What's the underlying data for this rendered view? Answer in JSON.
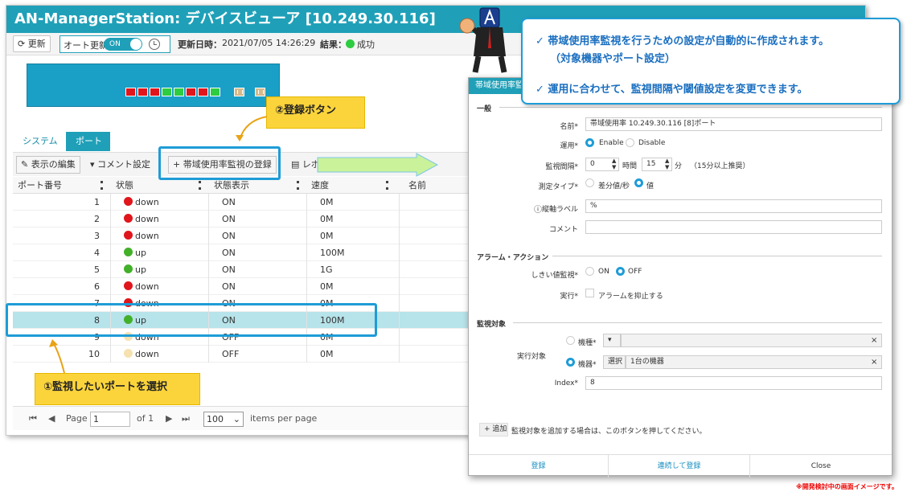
{
  "window": {
    "title": "AN-ManagerStation: デバイスビューア [10.249.30.116]"
  },
  "topbar": {
    "refresh_label": "更新",
    "auto_refresh_label": "オート更新",
    "toggle_label": "ON",
    "updated_label": "更新日時：",
    "updated_value": "2021/07/05 14:26:29",
    "result_label": "結果：",
    "result_value": "成功",
    "result_color": "#2ecc40"
  },
  "device": {
    "ports": [
      "red",
      "red",
      "red",
      "green",
      "green",
      "red",
      "red",
      "green",
      "tan",
      "tan"
    ]
  },
  "tabs": {
    "system": "システム",
    "port": "ポート"
  },
  "toolbar": {
    "edit_display": "表示の編集",
    "comment_settings": "コメント設定",
    "register_bw": "帯域使用率監視の登録",
    "report": "レポー"
  },
  "grid": {
    "headers": [
      "ポート番号",
      "状態",
      "状態表示",
      "速度",
      "名前"
    ],
    "rows": [
      {
        "port": "1",
        "status": "down",
        "status_color": "#e0161c",
        "display": "ON",
        "speed": "0M"
      },
      {
        "port": "2",
        "status": "down",
        "status_color": "#e0161c",
        "display": "ON",
        "speed": "0M"
      },
      {
        "port": "3",
        "status": "down",
        "status_color": "#e0161c",
        "display": "ON",
        "speed": "0M"
      },
      {
        "port": "4",
        "status": "up",
        "status_color": "#43b02a",
        "display": "ON",
        "speed": "100M"
      },
      {
        "port": "5",
        "status": "up",
        "status_color": "#43b02a",
        "display": "ON",
        "speed": "1G"
      },
      {
        "port": "6",
        "status": "down",
        "status_color": "#e0161c",
        "display": "ON",
        "speed": "0M"
      },
      {
        "port": "7",
        "status": "down",
        "status_color": "#e0161c",
        "display": "ON",
        "speed": "0M"
      },
      {
        "port": "8",
        "status": "up",
        "status_color": "#43b02a",
        "display": "ON",
        "speed": "100M"
      },
      {
        "port": "9",
        "status": "down",
        "status_color": "#f6e2b0",
        "display": "OFF",
        "speed": "0M"
      },
      {
        "port": "10",
        "status": "down",
        "status_color": "#f6e2b0",
        "display": "OFF",
        "speed": "0M"
      }
    ],
    "selected_port": "8"
  },
  "pager": {
    "page_label": "Page",
    "page_value": "1",
    "of_label": "of 1",
    "per_page_value": "100",
    "per_page_label": "items per page"
  },
  "callouts": {
    "register_button": "②登録ボタン",
    "select_port": "①監視したいポートを選択"
  },
  "bubble": {
    "line1": "✓ 帯域使用率監視を行うための設定が自動的に作成されます。",
    "line2": "（対象機器やポート設定）",
    "line3": "✓ 運用に合わせて、監視間隔や閾値設定を変更できます。"
  },
  "dialog": {
    "title": "帯域使用率監",
    "section_general": "一般",
    "name_label": "名前*",
    "name_value": "帯域使用率 10.249.30.116 [8]ポート",
    "operation_label": "運用*",
    "enable": "Enable",
    "disable": "Disable",
    "interval_label": "監視間隔*",
    "interval_hours": "0",
    "hours_unit": "時間",
    "interval_minutes": "15",
    "minutes_unit": "分",
    "interval_note": "（15分以上推奨）",
    "measure_label": "測定タイプ*",
    "measure_diff": "差分値/秒",
    "measure_value": "値",
    "vlabel_label": "縦軸ラベル",
    "vlabel_value": "%",
    "comment_label": "コメント",
    "section_alarm": "アラーム・アクション",
    "threshold_label": "しきい値監視*",
    "on": "ON",
    "off": "OFF",
    "exec_label": "実行*",
    "suppress_alarm": "アラームを抑止する",
    "section_target": "監視対象",
    "exec_target_label": "実行対象",
    "model_label": "機種*",
    "device_label": "機器*",
    "select_btn": "選択",
    "device_value": "1台の機器",
    "index_label": "Index*",
    "index_value": "8",
    "add_btn": "追加",
    "add_hint": "監視対象を追加する場合は、このボタンを押してください。",
    "footer_register": "登録",
    "footer_register_continue": "連続して登録",
    "footer_close": "Close"
  },
  "note": "※開発検討中の画面イメージです。"
}
